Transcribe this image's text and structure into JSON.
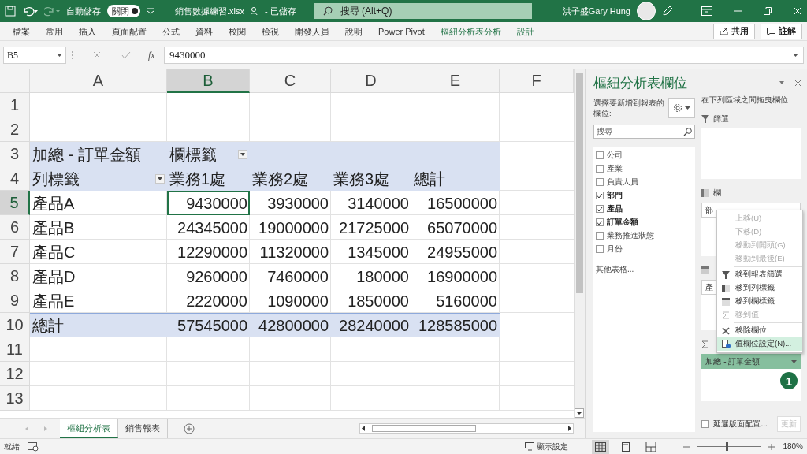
{
  "title_bar": {
    "autosave_label": "自動儲存",
    "autosave_toggle": "關閉",
    "file_name": "銷售數據練習.xlsx",
    "save_status": "- 已儲存",
    "search_placeholder": "搜尋 (Alt+Q)",
    "user_name": "洪子盛Gary Hung"
  },
  "ribbon": {
    "tabs": [
      {
        "label": "檔案",
        "contextual": false,
        "selected": false
      },
      {
        "label": "常用",
        "contextual": false,
        "selected": false
      },
      {
        "label": "插入",
        "contextual": false,
        "selected": false
      },
      {
        "label": "頁面配置",
        "contextual": false,
        "selected": false
      },
      {
        "label": "公式",
        "contextual": false,
        "selected": false
      },
      {
        "label": "資料",
        "contextual": false,
        "selected": false
      },
      {
        "label": "校閱",
        "contextual": false,
        "selected": false
      },
      {
        "label": "檢視",
        "contextual": false,
        "selected": false
      },
      {
        "label": "開發人員",
        "contextual": false,
        "selected": false
      },
      {
        "label": "說明",
        "contextual": false,
        "selected": false
      },
      {
        "label": "Power Pivot",
        "contextual": false,
        "selected": false
      },
      {
        "label": "樞紐分析表分析",
        "contextual": true,
        "selected": false
      },
      {
        "label": "設計",
        "contextual": true,
        "selected": false
      }
    ],
    "share_button": "共用",
    "comments_button": "註解"
  },
  "formula_bar": {
    "name_box": "B5",
    "function_label": "fx",
    "value": "9430000"
  },
  "grid": {
    "columns": [
      {
        "label": "A",
        "selected": false
      },
      {
        "label": "B",
        "selected": true
      },
      {
        "label": "C",
        "selected": false
      },
      {
        "label": "D",
        "selected": false
      },
      {
        "label": "E",
        "selected": false
      },
      {
        "label": "F",
        "selected": false
      }
    ],
    "rows": [
      {
        "number": "1",
        "kind": "empty",
        "selected": false,
        "cells": []
      },
      {
        "number": "2",
        "kind": "empty",
        "selected": false,
        "cells": []
      },
      {
        "number": "3",
        "kind": "header",
        "selected": false,
        "cells": [
          {
            "text": "加總 - 訂單金額"
          },
          {
            "text": "欄標籤",
            "dropdown": true
          }
        ]
      },
      {
        "number": "4",
        "kind": "header",
        "selected": false,
        "cells": [
          {
            "text": "列標籤",
            "dropdown": true
          },
          {
            "text": "業務1處"
          },
          {
            "text": "業務2處"
          },
          {
            "text": "業務3處"
          },
          {
            "text": "總計"
          }
        ]
      },
      {
        "number": "5",
        "kind": "data",
        "selected": true,
        "cells": [
          {
            "text": "產品A"
          },
          {
            "text": "9430000"
          },
          {
            "text": "3930000"
          },
          {
            "text": "3140000"
          },
          {
            "text": "16500000"
          }
        ]
      },
      {
        "number": "6",
        "kind": "data",
        "selected": false,
        "cells": [
          {
            "text": "產品B"
          },
          {
            "text": "24345000"
          },
          {
            "text": "19000000"
          },
          {
            "text": "21725000"
          },
          {
            "text": "65070000"
          }
        ]
      },
      {
        "number": "7",
        "kind": "data",
        "selected": false,
        "cells": [
          {
            "text": "產品C"
          },
          {
            "text": "12290000"
          },
          {
            "text": "11320000"
          },
          {
            "text": "1345000"
          },
          {
            "text": "24955000"
          }
        ]
      },
      {
        "number": "8",
        "kind": "data",
        "selected": false,
        "cells": [
          {
            "text": "產品D"
          },
          {
            "text": "9260000"
          },
          {
            "text": "7460000"
          },
          {
            "text": "180000"
          },
          {
            "text": "16900000"
          }
        ]
      },
      {
        "number": "9",
        "kind": "data",
        "selected": false,
        "cells": [
          {
            "text": "產品E"
          },
          {
            "text": "2220000"
          },
          {
            "text": "1090000"
          },
          {
            "text": "1850000"
          },
          {
            "text": "5160000"
          }
        ]
      },
      {
        "number": "10",
        "kind": "total",
        "selected": false,
        "cells": [
          {
            "text": "總計"
          },
          {
            "text": "57545000"
          },
          {
            "text": "42800000"
          },
          {
            "text": "28240000"
          },
          {
            "text": "128585000"
          }
        ]
      },
      {
        "number": "11",
        "kind": "empty",
        "selected": false,
        "cells": []
      },
      {
        "number": "12",
        "kind": "empty",
        "selected": false,
        "cells": []
      },
      {
        "number": "13",
        "kind": "empty",
        "selected": false,
        "cells": []
      }
    ]
  },
  "sheet_tabs": [
    {
      "label": "樞紐分析表",
      "selected": true
    },
    {
      "label": "銷售報表",
      "selected": false
    }
  ],
  "pivot_pane": {
    "title": "樞紐分析表欄位",
    "choose_label": "選擇要新增到報表的欄位:",
    "search_placeholder": "搜尋",
    "fields": [
      {
        "label": "公司",
        "checked": false
      },
      {
        "label": "產業",
        "checked": false
      },
      {
        "label": "負責人員",
        "checked": false
      },
      {
        "label": "部門",
        "checked": true
      },
      {
        "label": "產品",
        "checked": true
      },
      {
        "label": "訂單金額",
        "checked": true
      },
      {
        "label": "業務推進狀態",
        "checked": false
      },
      {
        "label": "月份",
        "checked": false
      }
    ],
    "more_tables": "其他表格...",
    "drag_label": "在下列區域之間拖曳欄位:",
    "areas": [
      {
        "kind": "filters",
        "label": "篩選"
      },
      {
        "kind": "columns",
        "label": "欄",
        "items": [
          {
            "label": "部",
            "selected": false
          }
        ]
      },
      {
        "kind": "rows",
        "items": [
          {
            "label": "產",
            "selected": false
          }
        ]
      },
      {
        "kind": "values",
        "items": [
          {
            "label": "加總 - 訂單金額",
            "selected": true
          }
        ]
      }
    ],
    "defer_layout": {
      "label": "延遲版面配置...",
      "checked": false
    },
    "update_button": {
      "label": "更新",
      "disabled": true
    }
  },
  "context_menu": {
    "items": [
      {
        "label": "上移(U)",
        "kind": "plain",
        "disabled": true,
        "selected": false,
        "separator_before": false
      },
      {
        "label": "下移(D)",
        "kind": "plain",
        "disabled": true,
        "selected": false,
        "separator_before": false
      },
      {
        "label": "移動到開頭(G)",
        "kind": "plain",
        "disabled": true,
        "selected": false,
        "separator_before": false
      },
      {
        "label": "移動到最後(E)",
        "kind": "plain",
        "disabled": true,
        "selected": false,
        "separator_before": false
      },
      {
        "label": "移到報表篩選",
        "kind": "filter",
        "disabled": false,
        "selected": false,
        "separator_before": true
      },
      {
        "label": "移到列標籤",
        "kind": "rows",
        "disabled": false,
        "selected": false,
        "separator_before": false
      },
      {
        "label": "移到欄標籤",
        "kind": "columns",
        "disabled": false,
        "selected": false,
        "separator_before": false
      },
      {
        "label": "移到值",
        "kind": "sigma",
        "disabled": true,
        "selected": false,
        "separator_before": false
      },
      {
        "label": "移除欄位",
        "kind": "remove",
        "disabled": false,
        "selected": false,
        "separator_before": true
      },
      {
        "label": "值欄位設定(N)...",
        "kind": "settings",
        "disabled": false,
        "selected": true,
        "separator_before": false
      }
    ]
  },
  "step_badge": "1",
  "status_bar": {
    "ready": "就緒",
    "display_settings": "顯示設定",
    "views": [
      {
        "kind": "normal",
        "selected": true
      },
      {
        "kind": "page_layout",
        "selected": false
      },
      {
        "kind": "page_break",
        "selected": false
      }
    ],
    "zoom": {
      "level": 0.45,
      "label": "180%"
    }
  }
}
